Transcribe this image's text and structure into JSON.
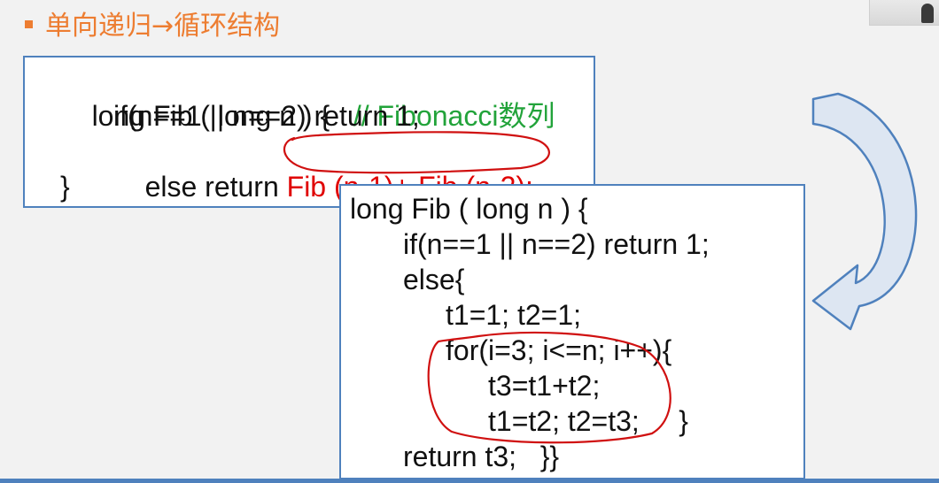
{
  "slide": {
    "title": "单向递归→循环结构"
  },
  "recursive": {
    "line1_code": "long Fib ( long n ) {",
    "line1_comment": "// Fibonacci数列",
    "line2": "if(n==1 || n==2) return 1;",
    "line3_prefix": "else return ",
    "line3_highlight": "Fib (n-1)+ Fib (n-2);",
    "line4": "}"
  },
  "iterative": {
    "lines": [
      "long Fib ( long n ) {",
      "if(n==1 || n==2) return 1;",
      "else{",
      "t1=1; t2=1;",
      "for(i=3; i<=n; i++){",
      "t3=t1+t2;",
      "t1=t2; t2=t3;     }",
      "return t3;   }}"
    ]
  },
  "colors": {
    "title": "#ed7d31",
    "box_border": "#4f81bd",
    "comment": "#22a33a",
    "highlight": "#e00000",
    "annotation": "#d01010",
    "arrow_fill": "#dde6f2",
    "arrow_stroke": "#4f81bd"
  },
  "icons": {
    "transform_arrow": "curved-arrow-icon",
    "bullet": "square-bullet-icon"
  }
}
